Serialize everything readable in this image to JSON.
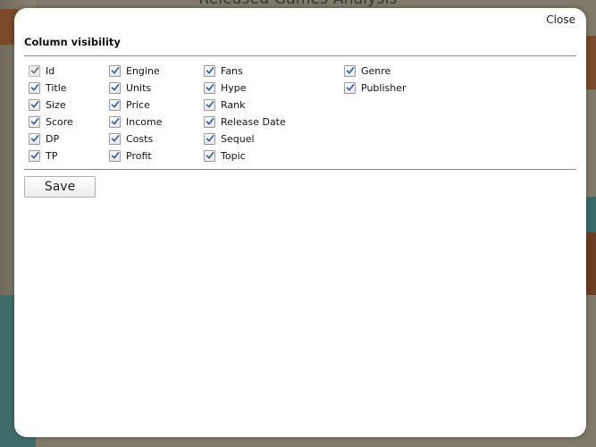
{
  "background": {
    "title": "Released Games Analysis"
  },
  "modal": {
    "close_label": "Close",
    "section_title": "Column visibility",
    "save_label": "Save",
    "columns": [
      [
        {
          "label": "Id",
          "checked": true,
          "disabled": true
        },
        {
          "label": "Title",
          "checked": true,
          "disabled": false
        },
        {
          "label": "Size",
          "checked": true,
          "disabled": false
        },
        {
          "label": "Score",
          "checked": true,
          "disabled": false
        },
        {
          "label": "DP",
          "checked": true,
          "disabled": false
        },
        {
          "label": "TP",
          "checked": true,
          "disabled": false
        }
      ],
      [
        {
          "label": "Engine",
          "checked": true,
          "disabled": false
        },
        {
          "label": "Units",
          "checked": true,
          "disabled": false
        },
        {
          "label": "Price",
          "checked": true,
          "disabled": false
        },
        {
          "label": "Income",
          "checked": true,
          "disabled": false
        },
        {
          "label": "Costs",
          "checked": true,
          "disabled": false
        },
        {
          "label": "Profit",
          "checked": true,
          "disabled": false
        }
      ],
      [
        {
          "label": "Fans",
          "checked": true,
          "disabled": false
        },
        {
          "label": "Hype",
          "checked": true,
          "disabled": false
        },
        {
          "label": "Rank",
          "checked": true,
          "disabled": false
        },
        {
          "label": "Release Date",
          "checked": true,
          "disabled": false
        },
        {
          "label": "Sequel",
          "checked": true,
          "disabled": false
        },
        {
          "label": "Topic",
          "checked": true,
          "disabled": false
        }
      ],
      [
        {
          "label": "Genre",
          "checked": true,
          "disabled": false
        },
        {
          "label": "Publisher",
          "checked": true,
          "disabled": false
        }
      ]
    ]
  }
}
